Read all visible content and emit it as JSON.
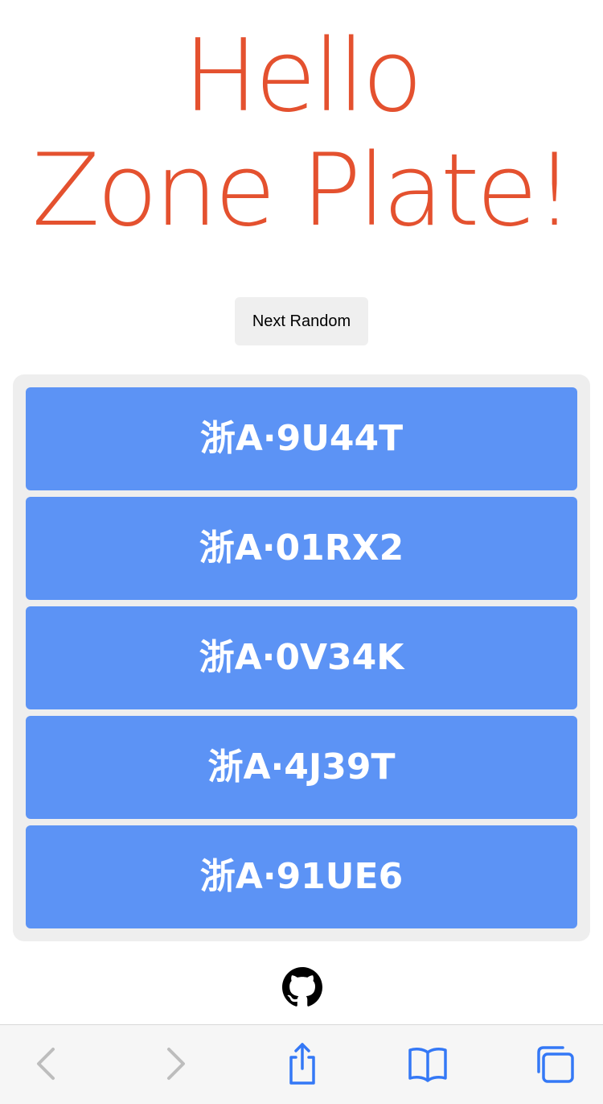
{
  "header": {
    "title_line1": "Hello",
    "title_line2": "Zone Plate!"
  },
  "controls": {
    "next_random_label": "Next Random"
  },
  "plates": [
    "浙A·9U44T",
    "浙A·01RX2",
    "浙A·0V34K",
    "浙A·4J39T",
    "浙A·91UE6"
  ],
  "footer": {
    "icon": "github-icon"
  },
  "browser_toolbar": {
    "icons": [
      "back-icon",
      "forward-icon",
      "share-icon",
      "bookmarks-icon",
      "tabs-icon"
    ]
  },
  "colors": {
    "title": "#e4512f",
    "plate_background": "#5c93f5",
    "list_background": "#eeeeee",
    "toolbar_accent": "#3478f6",
    "toolbar_disabled": "#bdbdbd"
  }
}
